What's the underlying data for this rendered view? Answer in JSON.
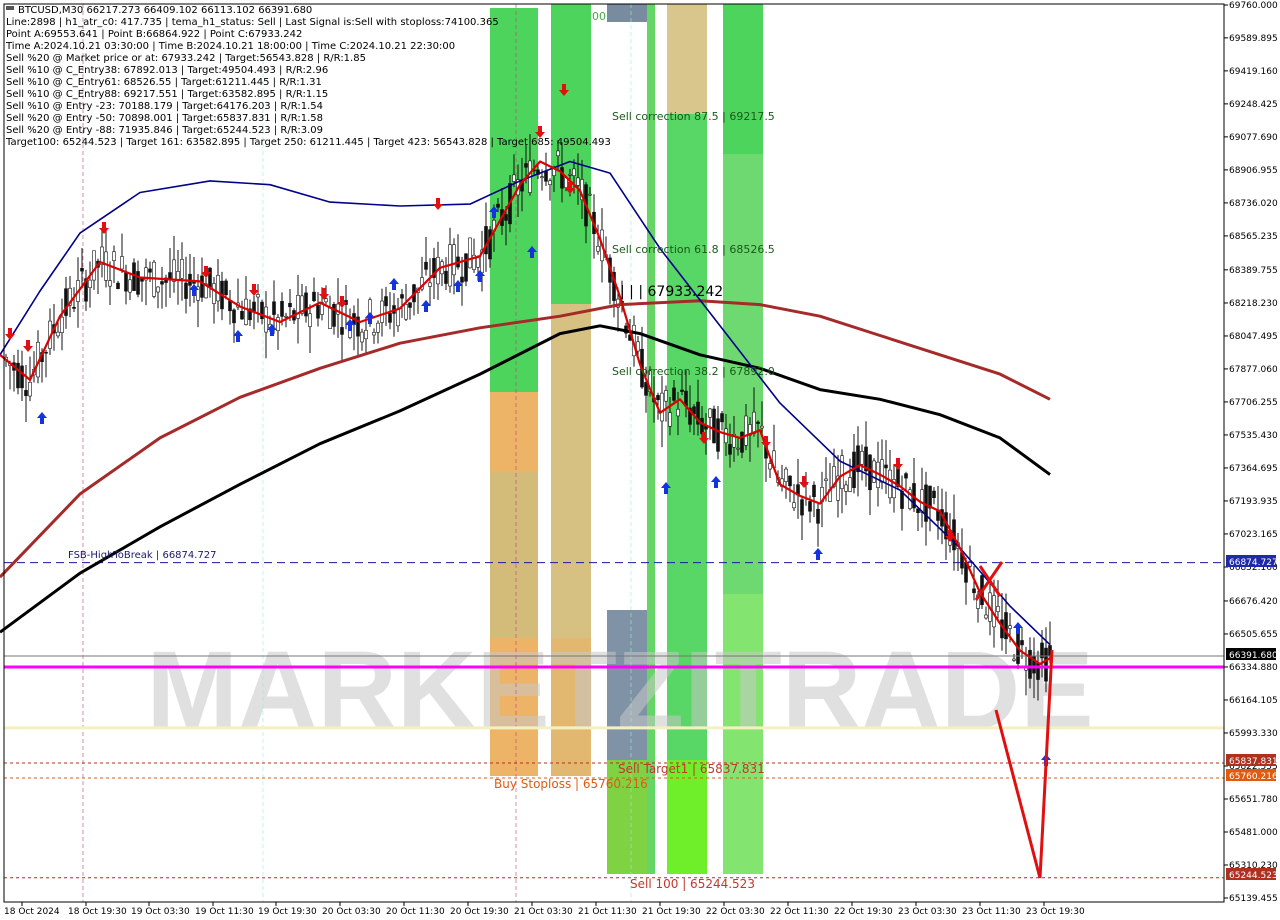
{
  "header": {
    "lines": [
      "BTCUSD,M30  66217.273 66409.102 66113.102 66391.680",
      "Line:2898 | h1_atr_c0: 417.735 | tema_h1_status: Sell | Last Signal is:Sell with stoploss:74100.365",
      "Point A:69553.641 | Point B:66864.922 | Point C:67933.242",
      "Time A:2024.10.21 03:30:00 | Time B:2024.10.21 18:00:00 | Time C:2024.10.21 22:30:00",
      "Sell %20 @ Market price or at: 67933.242 | Target:56543.828 | R/R:1.85",
      "Sell %10 @ C_Entry38: 67892.013 | Target:49504.493 | R/R:2.96",
      "Sell %10 @ C_Entry61: 68526.55 | Target:61211.445 | R/R:1.31",
      "Sell %10 @ C_Entry88: 69217.551 | Target:63582.895 | R/R:1.15",
      "Sell %10 @ Entry -23: 70188.179 | Target:64176.203 | R/R:1.54",
      "Sell %20 @ Entry -50: 70898.001 | Target:65837.831 | R/R:1.58",
      "Sell %20 @ Entry -88: 71935.846 | Target:65244.523 | R/R:3.09",
      "Target100: 65244.523 | Target 161: 63582.895 | Target 250: 61211.445 | Target 423: 56543.828 | Target 685: 49504.493"
    ]
  },
  "watermark": "MARKETZITRADE",
  "annotations": {
    "fsb": "FSB-HighToBreak | 66874.727",
    "sell_corr_875": "Sell correction 87.5 | 69217.5",
    "sell_corr_618": "Sell correction 61.8 | 68526.5",
    "sell_corr_382": "Sell correction 38.2 | 67892.0",
    "point_c": "| | | 67933.242",
    "sell_target1": "Sell Target1 | 65837.831",
    "buy_stoploss": "Buy Stoploss | 65760.216",
    "sell_100": "Sell 100 | 65244.523",
    "zero_label": "00"
  },
  "price_tags": {
    "fsb": "66874.727",
    "current": "66391.680",
    "target1": "65837.831",
    "stoploss": "65760.216",
    "sell100": "65244.523"
  },
  "colors": {
    "background": "#ffffff",
    "magenta_line": "#ff00ff",
    "fsb_line": "#0000aa",
    "ma_black": "#000000",
    "ma_darkred": "#a52a2a",
    "ma_navy": "#00008b",
    "tema_red": "#dd0000",
    "green_zone": "#2ecc40",
    "orange_zone": "#e8a040",
    "steel_zone": "#6a7f95",
    "lime_zone": "#7fff00"
  },
  "chart_data": {
    "type": "line",
    "symbol": "BTCUSD",
    "timeframe": "M30",
    "ylim": [
      65139.455,
      69760.0
    ],
    "y_ticks": [
      "69760.000",
      "69589.895",
      "69419.160",
      "69248.425",
      "69077.690",
      "68906.955",
      "68736.020",
      "68565.235",
      "68389.755",
      "68218.230",
      "68047.495",
      "67877.060",
      "67706.255",
      "67535.430",
      "67364.695",
      "67193.935",
      "67023.165",
      "66852.160",
      "66676.420",
      "66505.655",
      "66334.880",
      "66164.105",
      "65993.330",
      "65822.555",
      "65651.780",
      "65481.000",
      "65310.230",
      "65139.455"
    ],
    "x_ticks": [
      "18 Oct 2024",
      "18 Oct 19:30",
      "19 Oct 03:30",
      "19 Oct 11:30",
      "19 Oct 19:30",
      "20 Oct 03:30",
      "20 Oct 11:30",
      "20 Oct 19:30",
      "21 Oct 03:30",
      "21 Oct 11:30",
      "21 Oct 19:30",
      "22 Oct 03:30",
      "22 Oct 11:30",
      "22 Oct 19:30",
      "23 Oct 03:30",
      "23 Oct 11:30",
      "23 Oct 19:30"
    ],
    "levels": {
      "fsb_high_to_break": 66874.727,
      "current_price": 66391.68,
      "magenta": 66334.88,
      "cream": 66020.0,
      "sell_target1": 65837.831,
      "buy_stoploss": 65760.216,
      "sell_100": 65244.523
    },
    "series": [
      {
        "name": "",
        "color": "#000000",
        "x": [
          0,
          80,
          160,
          240,
          320,
          400,
          480,
          560,
          600,
          640,
          700,
          760,
          820,
          880,
          940,
          1000,
          1050
        ],
        "y": [
          66515,
          66820,
          67060,
          67280,
          67490,
          67660,
          67850,
          68060,
          68100,
          68060,
          67950,
          67880,
          67770,
          67720,
          67640,
          67520,
          67330
        ]
      },
      {
        "name": "",
        "color": "#a52a2a",
        "x": [
          0,
          80,
          160,
          240,
          320,
          400,
          480,
          560,
          620,
          700,
          760,
          820,
          880,
          940,
          1000,
          1050
        ],
        "y": [
          66800,
          67230,
          67520,
          67730,
          67880,
          68010,
          68090,
          68150,
          68210,
          68230,
          68210,
          68150,
          68050,
          67950,
          67850,
          67720
        ]
      },
      {
        "name": "",
        "color": "#00008b",
        "x": [
          0,
          40,
          80,
          140,
          210,
          270,
          330,
          400,
          470,
          520,
          570,
          610,
          660,
          720,
          780,
          840,
          900,
          960,
          1010,
          1050
        ],
        "y": [
          67950,
          68280,
          68580,
          68790,
          68850,
          68830,
          68740,
          68720,
          68730,
          68850,
          68950,
          68890,
          68500,
          68100,
          67700,
          67400,
          67250,
          66950,
          66650,
          66450
        ]
      },
      {
        "name": "",
        "color": "#dd0000",
        "x": [
          0,
          30,
          60,
          100,
          140,
          200,
          240,
          280,
          320,
          360,
          400,
          440,
          480,
          520,
          540,
          560,
          580,
          600,
          620,
          640,
          660,
          680,
          700,
          720,
          740,
          760,
          780,
          800,
          820,
          840,
          860,
          880,
          900,
          920,
          940,
          960,
          980,
          1000,
          1020,
          1040,
          1050
        ],
        "y": [
          67950,
          67820,
          68150,
          68430,
          68350,
          68330,
          68200,
          68120,
          68220,
          68120,
          68190,
          68400,
          68460,
          68830,
          68950,
          68900,
          68800,
          68550,
          68250,
          67900,
          67650,
          67720,
          67600,
          67550,
          67520,
          67560,
          67280,
          67220,
          67180,
          67320,
          67380,
          67330,
          67270,
          67190,
          67140,
          66950,
          66720,
          66560,
          66420,
          66350,
          66380
        ]
      }
    ]
  }
}
